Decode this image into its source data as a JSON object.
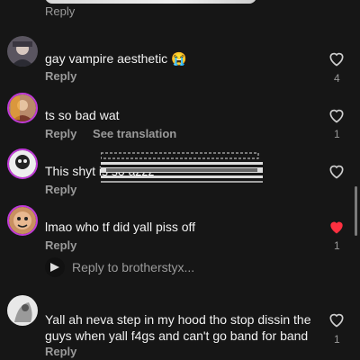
{
  "top": {
    "reply_label": "Reply"
  },
  "comments": [
    {
      "text": "gay vampire aesthetic 😭",
      "reply_label": "Reply",
      "like_count": "4",
      "liked": false
    },
    {
      "text": "ts so bad wat",
      "reply_label": "Reply",
      "translate_label": "See translation",
      "like_count": "1",
      "liked": false
    },
    {
      "text": "This shyt is so azzz",
      "reply_label": "Reply",
      "like_count": "",
      "liked": false
    },
    {
      "text": "lmao who tf did yall piss off",
      "reply_label": "Reply",
      "like_count": "1",
      "liked": true,
      "view_replies_label": "Reply to brotherstyx..."
    },
    {
      "text": "Yall ah neva step in my hood tho stop dissin the guys when yall f4gs and can't go band for band",
      "reply_label": "Reply",
      "like_count": "1",
      "liked": false
    }
  ],
  "colors": {
    "background": "#161616",
    "like_red": "#ff3040",
    "muted": "#9a9a9a",
    "avatar_ring": "#c03ad8"
  },
  "icons": {
    "like": "heart-icon",
    "liked": "heart-filled-icon"
  }
}
